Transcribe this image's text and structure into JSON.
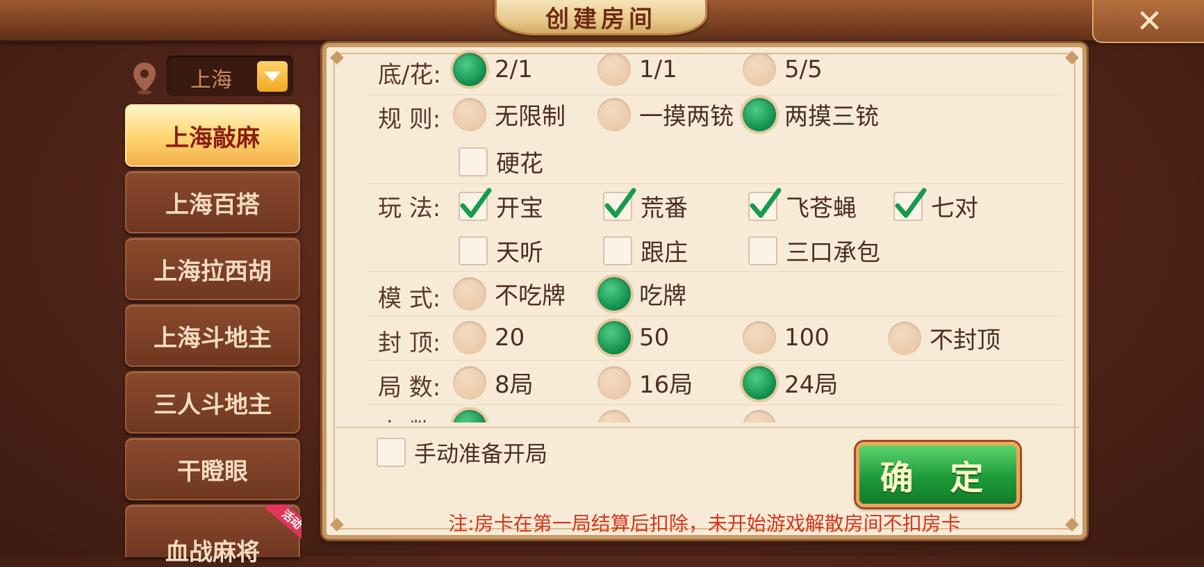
{
  "header": {
    "title": "创建房间",
    "close_icon": "close-icon"
  },
  "region": {
    "value": "上海",
    "icon": "location-pin-icon"
  },
  "games": [
    {
      "label": "上海敲麻",
      "active": true
    },
    {
      "label": "上海百搭"
    },
    {
      "label": "上海拉西胡"
    },
    {
      "label": "上海斗地主"
    },
    {
      "label": "三人斗地主"
    },
    {
      "label": "干瞪眼"
    },
    {
      "label": "血战麻将",
      "badge": "活动"
    }
  ],
  "settings": {
    "base": {
      "label": "底/花:",
      "options": [
        "2/1",
        "1/1",
        "5/5"
      ],
      "selected": 0
    },
    "rules": {
      "label": "规 则:",
      "options": [
        "无限制",
        "一摸两铳",
        "两摸三铳"
      ],
      "selected": 2,
      "extra_check": {
        "label": "硬花",
        "checked": false
      }
    },
    "play": {
      "label": "玩 法:",
      "checks": [
        {
          "label": "开宝",
          "checked": true
        },
        {
          "label": "荒番",
          "checked": true
        },
        {
          "label": "飞苍蝇",
          "checked": true
        },
        {
          "label": "七对",
          "checked": true
        },
        {
          "label": "天听",
          "checked": false
        },
        {
          "label": "跟庄",
          "checked": false
        },
        {
          "label": "三口承包",
          "checked": false
        }
      ]
    },
    "mode": {
      "label": "模 式:",
      "options": [
        "不吃牌",
        "吃牌"
      ],
      "selected": 1
    },
    "cap": {
      "label": "封 顶:",
      "options": [
        "20",
        "50",
        "100",
        "不封顶"
      ],
      "selected": 1
    },
    "rounds": {
      "label": "局 数:",
      "options": [
        "8局",
        "16局",
        "24局"
      ],
      "selected": 2
    },
    "players": {
      "label": "人 数:",
      "selected": 0
    }
  },
  "footer": {
    "manual_ready": {
      "label": "手动准备开局",
      "checked": false
    },
    "confirm": "确 定",
    "note": "注:房卡在第一局结算后扣除，未开始游戏解散房间不扣房卡"
  }
}
